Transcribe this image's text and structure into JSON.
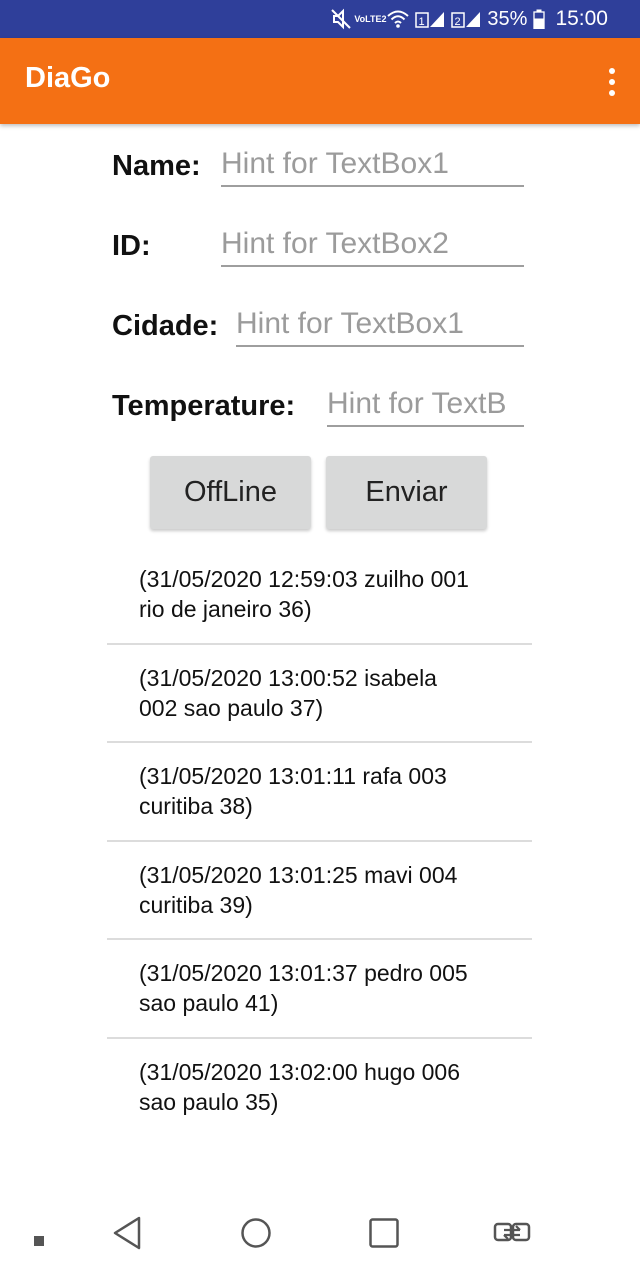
{
  "status_bar": {
    "volte_line1": "Vo",
    "volte_line2": "LTE2",
    "sim1_label": "1",
    "sim2_label": "2",
    "battery_percent": "35%",
    "time": "15:00",
    "icons": [
      "mute-icon",
      "volte-icon",
      "wifi-icon",
      "sim1-signal-icon",
      "sim2-signal-icon",
      "battery-icon"
    ]
  },
  "app_bar": {
    "title": "DiaGo",
    "menu_icon": "overflow-menu-icon"
  },
  "form": {
    "name_label": "Name:",
    "name_placeholder": "Hint for TextBox1",
    "id_label": "ID:",
    "id_placeholder": "Hint for TextBox2",
    "cidade_label": "Cidade:",
    "cidade_placeholder": "Hint for TextBox1",
    "temperature_label": "Temperature:",
    "temperature_placeholder": "Hint for TextB"
  },
  "buttons": {
    "offline_label": "OffLine",
    "enviar_label": "Enviar"
  },
  "records": [
    {
      "line1": "(31/05/2020 12:59:03 zuilho 001",
      "line2": "rio de janeiro 36)"
    },
    {
      "line1": "(31/05/2020 13:00:52 isabela",
      "line2": "002 sao paulo 37)"
    },
    {
      "line1": "(31/05/2020 13:01:11 rafa 003",
      "line2": "curitiba 38)"
    },
    {
      "line1": "(31/05/2020 13:01:25 mavi 004",
      "line2": "curitiba 39)"
    },
    {
      "line1": "(31/05/2020 13:01:37 pedro 005",
      "line2": "sao paulo 41)"
    },
    {
      "line1": "(31/05/2020 13:02:00 hugo 006",
      "line2": "sao paulo 35)"
    }
  ],
  "nav_bar": {
    "icons": [
      "dot-icon",
      "back-icon",
      "home-icon",
      "recents-icon",
      "switch-apps-icon"
    ]
  },
  "colors": {
    "status_bar": "#2f3f9a",
    "app_bar": "#f47014",
    "button": "#d8d9d9"
  }
}
